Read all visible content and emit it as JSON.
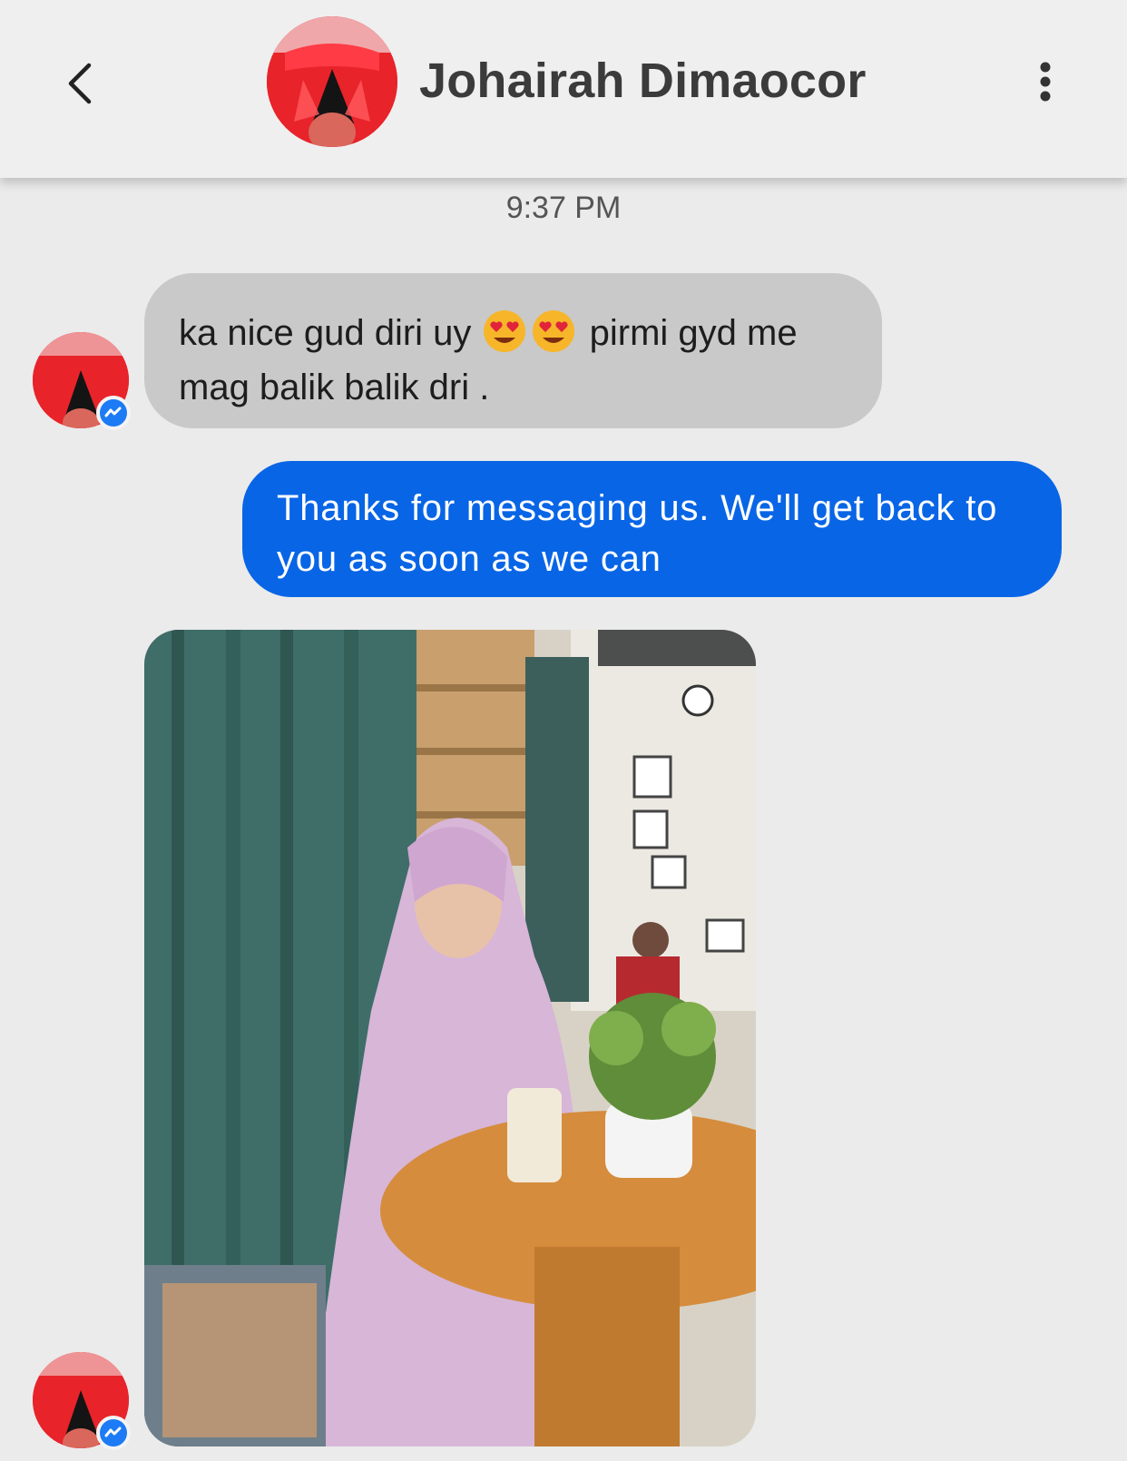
{
  "header": {
    "contact_name": "Johairah Dimaocor",
    "back_icon": "chevron-left-icon",
    "more_icon": "more-vertical-icon"
  },
  "conversation": {
    "timestamp": "9:37 PM",
    "messages": [
      {
        "sender": "contact",
        "type": "text",
        "text_part1": "ka nice gud diri uy ",
        "emoji": "heart-eyes-emoji",
        "text_part2": " pirmi gyd me mag balik balik dri ."
      },
      {
        "sender": "me",
        "type": "text",
        "text": "Thanks for messaging us. We'll get back to you as soon as we can"
      },
      {
        "sender": "contact",
        "type": "photo",
        "photo_icon": "photo-woman-cafe-image"
      }
    ]
  },
  "colors": {
    "incoming_bubble": "#c9c9c9",
    "outgoing_bubble": "#0865e6",
    "messenger_badge": "#1d7bf5",
    "avatar_red": "#e8232a"
  }
}
